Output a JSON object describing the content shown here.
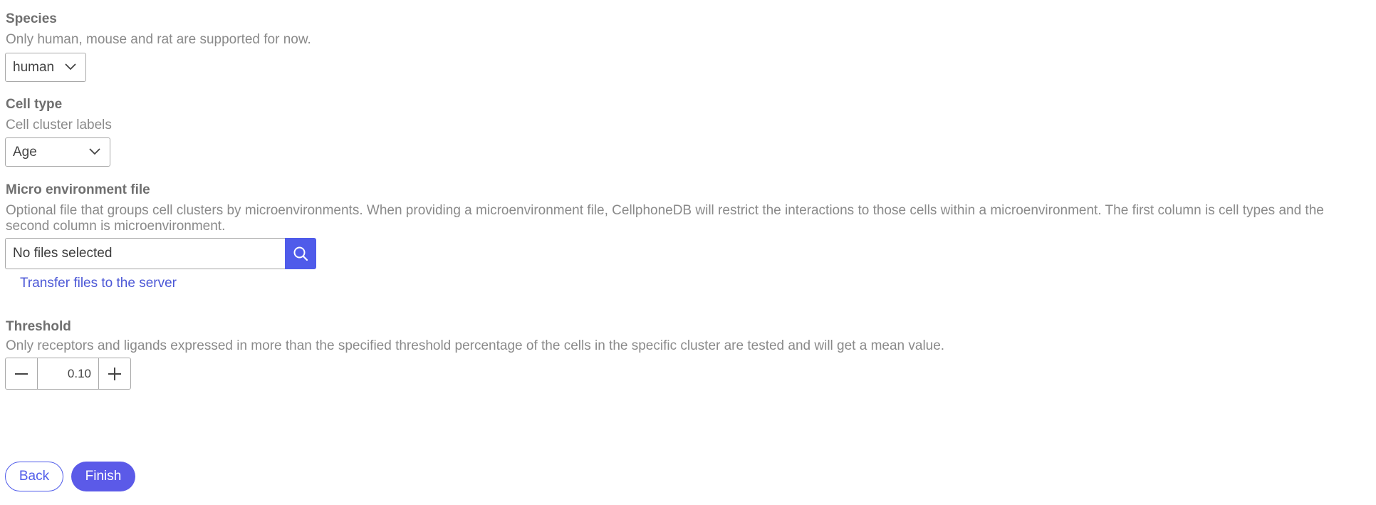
{
  "species": {
    "title": "Species",
    "description": "Only human, mouse and rat are supported for now.",
    "selected": "human"
  },
  "cell_type": {
    "title": "Cell type",
    "description": "Cell cluster labels",
    "selected": "Age"
  },
  "micro_env": {
    "title": "Micro environment file",
    "description": "Optional file that groups cell clusters by microenvironments. When providing a microenvironment file, CellphoneDB will restrict the interactions to those cells within a microenvironment. The first column is cell types and the second column is microenvironment.",
    "file_value": "No files selected",
    "browse_icon": "search-icon",
    "transfer_link": "Transfer files to the server"
  },
  "threshold": {
    "title": "Threshold",
    "description": "Only receptors and ligands expressed in more than the specified threshold percentage of the cells in the specific cluster are tested and will get a mean value.",
    "value": "0.10",
    "decrement_icon": "minus-icon",
    "increment_icon": "plus-icon"
  },
  "actions": {
    "back_label": "Back",
    "finish_label": "Finish"
  },
  "colors": {
    "accent": "#4f5bea",
    "link": "#4b57d6",
    "border": "#a8a8a8"
  }
}
